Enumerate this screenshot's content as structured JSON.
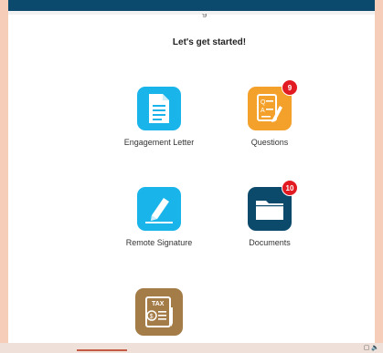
{
  "header": {
    "partial_text": "g"
  },
  "main": {
    "heading": "Let's get started!"
  },
  "tiles": {
    "engagement": {
      "label": "Engagement Letter",
      "color": "#18b4ea",
      "icon": "document-icon"
    },
    "questions": {
      "label": "Questions",
      "color": "#f3a12b",
      "icon": "questionnaire-icon",
      "badge": "9"
    },
    "signature": {
      "label": "Remote Signature",
      "color": "#18b4ea",
      "icon": "pencil-icon"
    },
    "documents": {
      "label": "Documents",
      "color": "#0c4a6c",
      "icon": "folder-icon",
      "badge": "10"
    },
    "tax": {
      "color": "#a47c48",
      "icon": "tax-icon",
      "icon_text": "TAX"
    }
  },
  "colors": {
    "topbar": "#0b4a6c",
    "badge": "#e21b23",
    "background": "#f5cdb9"
  }
}
